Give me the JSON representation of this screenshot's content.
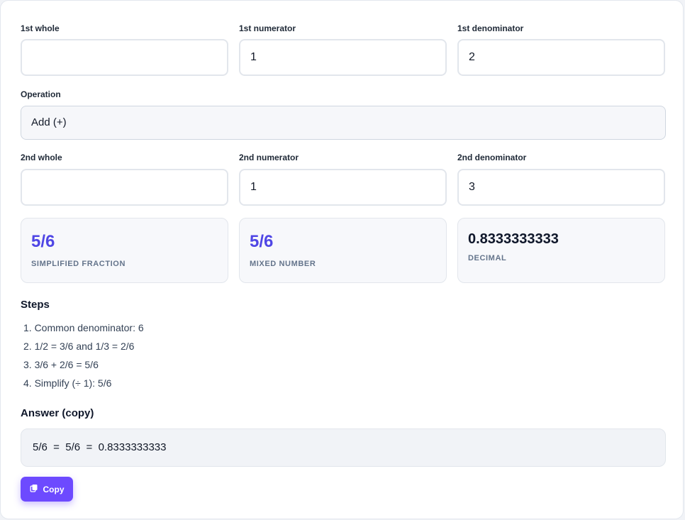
{
  "row1": {
    "whole": {
      "label": "1st whole",
      "value": ""
    },
    "numerator": {
      "label": "1st numerator",
      "value": "1"
    },
    "denominator": {
      "label": "1st denominator",
      "value": "2"
    }
  },
  "operation": {
    "label": "Operation",
    "value": "Add (+)"
  },
  "row2": {
    "whole": {
      "label": "2nd whole",
      "value": ""
    },
    "numerator": {
      "label": "2nd numerator",
      "value": "1"
    },
    "denominator": {
      "label": "2nd denominator",
      "value": "3"
    }
  },
  "results": {
    "simplified": {
      "value": "5/6",
      "label": "SIMPLIFIED FRACTION"
    },
    "mixed": {
      "value": "5/6",
      "label": "MIXED NUMBER"
    },
    "decimal": {
      "value": "0.8333333333",
      "label": "DECIMAL"
    }
  },
  "steps": {
    "title": "Steps",
    "items": [
      "1. Common denominator: 6",
      "2. 1/2 = 3/6 and 1/3 = 2/6",
      "3. 3/6 + 2/6 = 5/6",
      "4. Simplify (÷ 1): 5/6"
    ]
  },
  "answer": {
    "title": "Answer (copy)",
    "text": "5/6  =  5/6  =  0.8333333333"
  },
  "copy_button": {
    "label": "Copy",
    "icon": "copy-icon"
  },
  "colors": {
    "accent": "#4f46e5",
    "button": "#6d4aff"
  }
}
